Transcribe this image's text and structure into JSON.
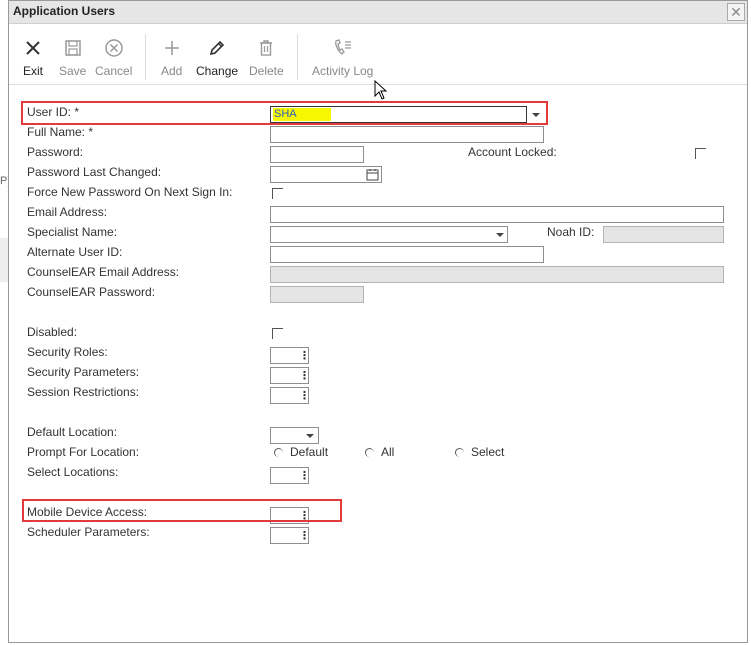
{
  "window": {
    "title": "Application Users",
    "close_glyph": "✕"
  },
  "toolbar": {
    "exit": "Exit",
    "save": "Save",
    "cancel": "Cancel",
    "add": "Add",
    "change": "Change",
    "delete": "Delete",
    "activity_log": "Activity Log"
  },
  "form": {
    "user_id_label": "User ID: *",
    "user_id_value": "SHA",
    "full_name_label": "Full Name: *",
    "password_label": "Password:",
    "account_locked_label": "Account Locked:",
    "password_last_changed_label": "Password Last Changed:",
    "force_new_password_label": "Force New Password On Next Sign In:",
    "email_label": "Email Address:",
    "specialist_label": "Specialist Name:",
    "noah_id_label": "Noah ID:",
    "alternate_user_id_label": "Alternate User ID:",
    "counselear_email_label": "CounselEAR Email Address:",
    "counselear_password_label": "CounselEAR Password:",
    "disabled_label": "Disabled:",
    "security_roles_label": "Security Roles:",
    "security_parameters_label": "Security Parameters:",
    "session_restrictions_label": "Session Restrictions:",
    "default_location_label": "Default Location:",
    "prompt_for_location_label": "Prompt For Location:",
    "prompt_options": [
      "Default",
      "All",
      "Select"
    ],
    "select_locations_label": "Select Locations:",
    "mobile_device_access_label": "Mobile Device Access:",
    "scheduler_parameters_label": "Scheduler Parameters:",
    "ellipsis": "⋮"
  },
  "colors": {
    "highlight_box": "#e23b3b",
    "text_highlight": "#f7f700"
  },
  "background": {
    "glyph": "P)"
  }
}
